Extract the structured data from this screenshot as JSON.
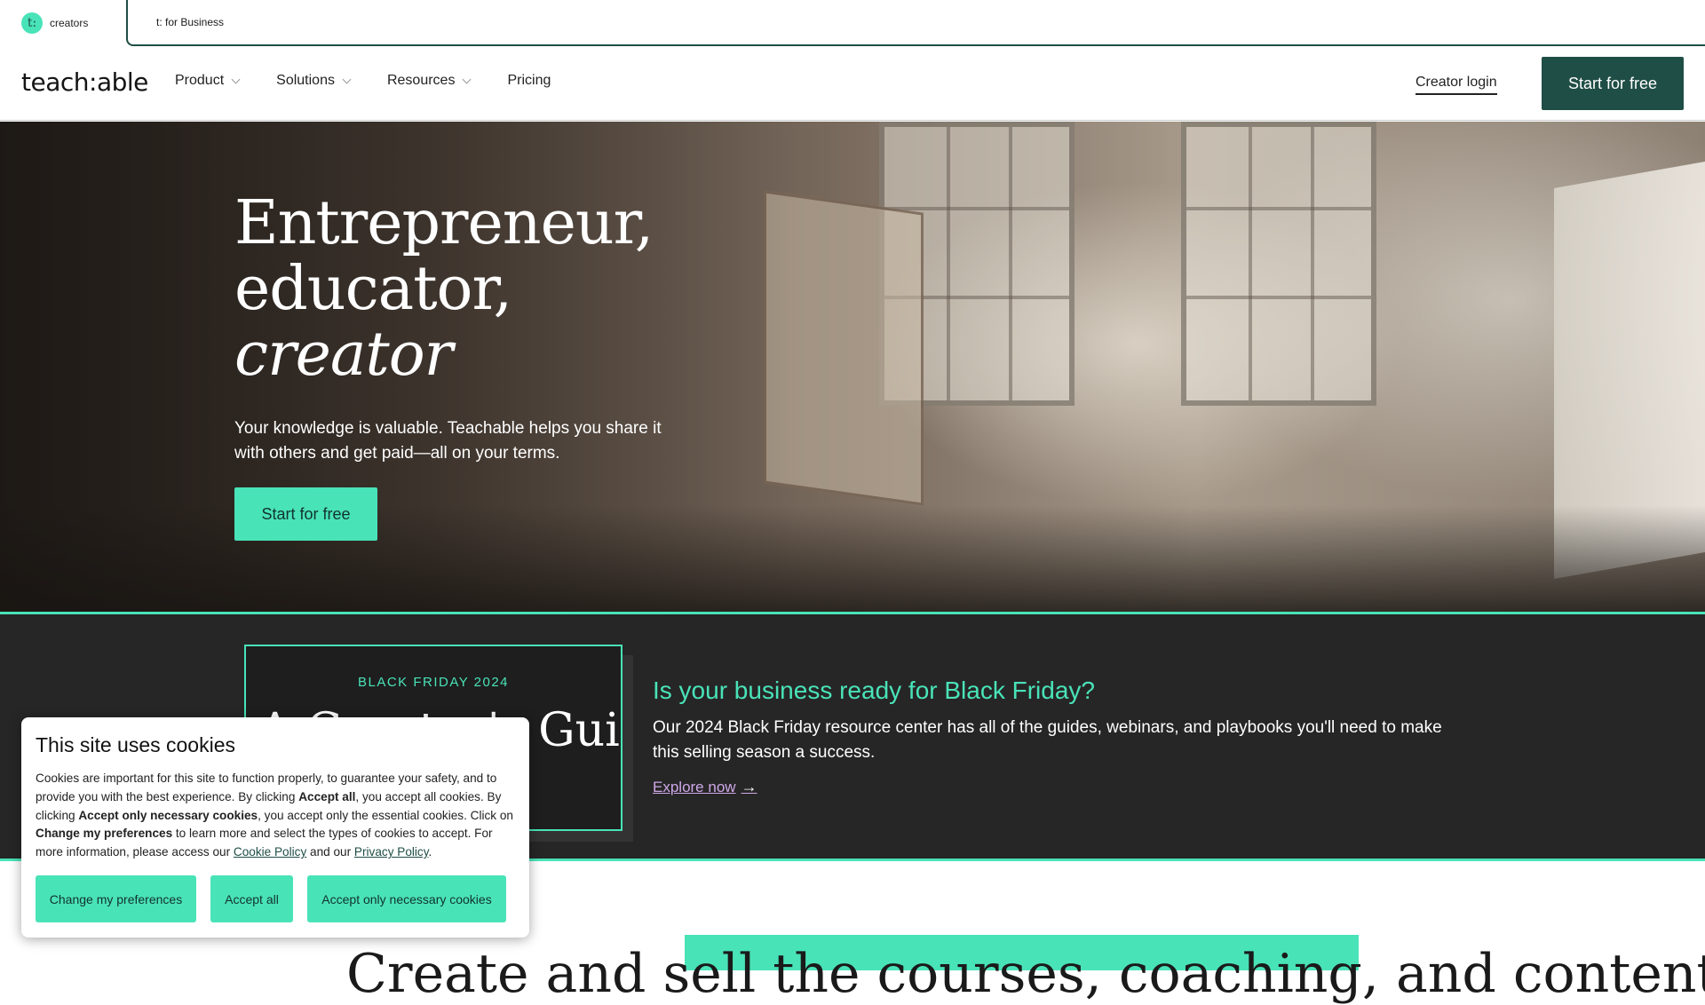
{
  "audience_switch": {
    "badge": "t:",
    "creators_label": "creators",
    "business_label": "t: for Business"
  },
  "nav": {
    "logo": "teach:able",
    "items": [
      {
        "label": "Product",
        "has_dropdown": true
      },
      {
        "label": "Solutions",
        "has_dropdown": true
      },
      {
        "label": "Resources",
        "has_dropdown": true
      },
      {
        "label": "Pricing",
        "has_dropdown": false
      }
    ],
    "creator_login": "Creator login",
    "start_button": "Start for free"
  },
  "hero": {
    "title_line1": "Entrepreneur,",
    "title_line2": "educator,",
    "title_line3": "creator",
    "subtitle": "Your knowledge is valuable. Teachable helps you share it with others and get paid—all on your terms.",
    "cta": "Start for free"
  },
  "black_friday": {
    "card_eyebrow": "BLACK FRIDAY 2024",
    "card_title": "A Creator's Guide to Black Friday",
    "headline": "Is your business ready for Black Friday?",
    "description": "Our 2024 Black Friday resource center has all of the guides, webinars, and playbooks you'll need to make this selling season a success.",
    "link": "Explore now"
  },
  "lower_section": {
    "heading_start": "Create and sell",
    "heading_highlight": "the courses, coaching, and content"
  },
  "cookie_dialog": {
    "title": "This site uses cookies",
    "text_1": "Cookies are important for this site to function properly, to guarantee your safety, and to provide you with the best experience. By clicking ",
    "accept_all_bold": "Accept all",
    "text_2": ", you accept all cookies. By clicking ",
    "accept_necessary_bold": "Accept only necessary cookies",
    "text_3": ", you accept only the essential cookies. Click on ",
    "change_prefs_bold": "Change my preferences",
    "text_4": " to learn more and select the types of cookies to accept. For more information, please access our ",
    "cookie_policy_link": "Cookie Policy",
    "text_5": " and our ",
    "privacy_policy_link": "Privacy Policy",
    "text_6": ".",
    "buttons": {
      "change_preferences": "Change my preferences",
      "accept_all": "Accept all",
      "accept_necessary": "Accept only necessary cookies"
    }
  },
  "colors": {
    "brand_dark_green": "#1f4e46",
    "brand_mint": "#49e3b8",
    "band_dark": "#262626",
    "link_lavender": "#cfa8e8"
  }
}
